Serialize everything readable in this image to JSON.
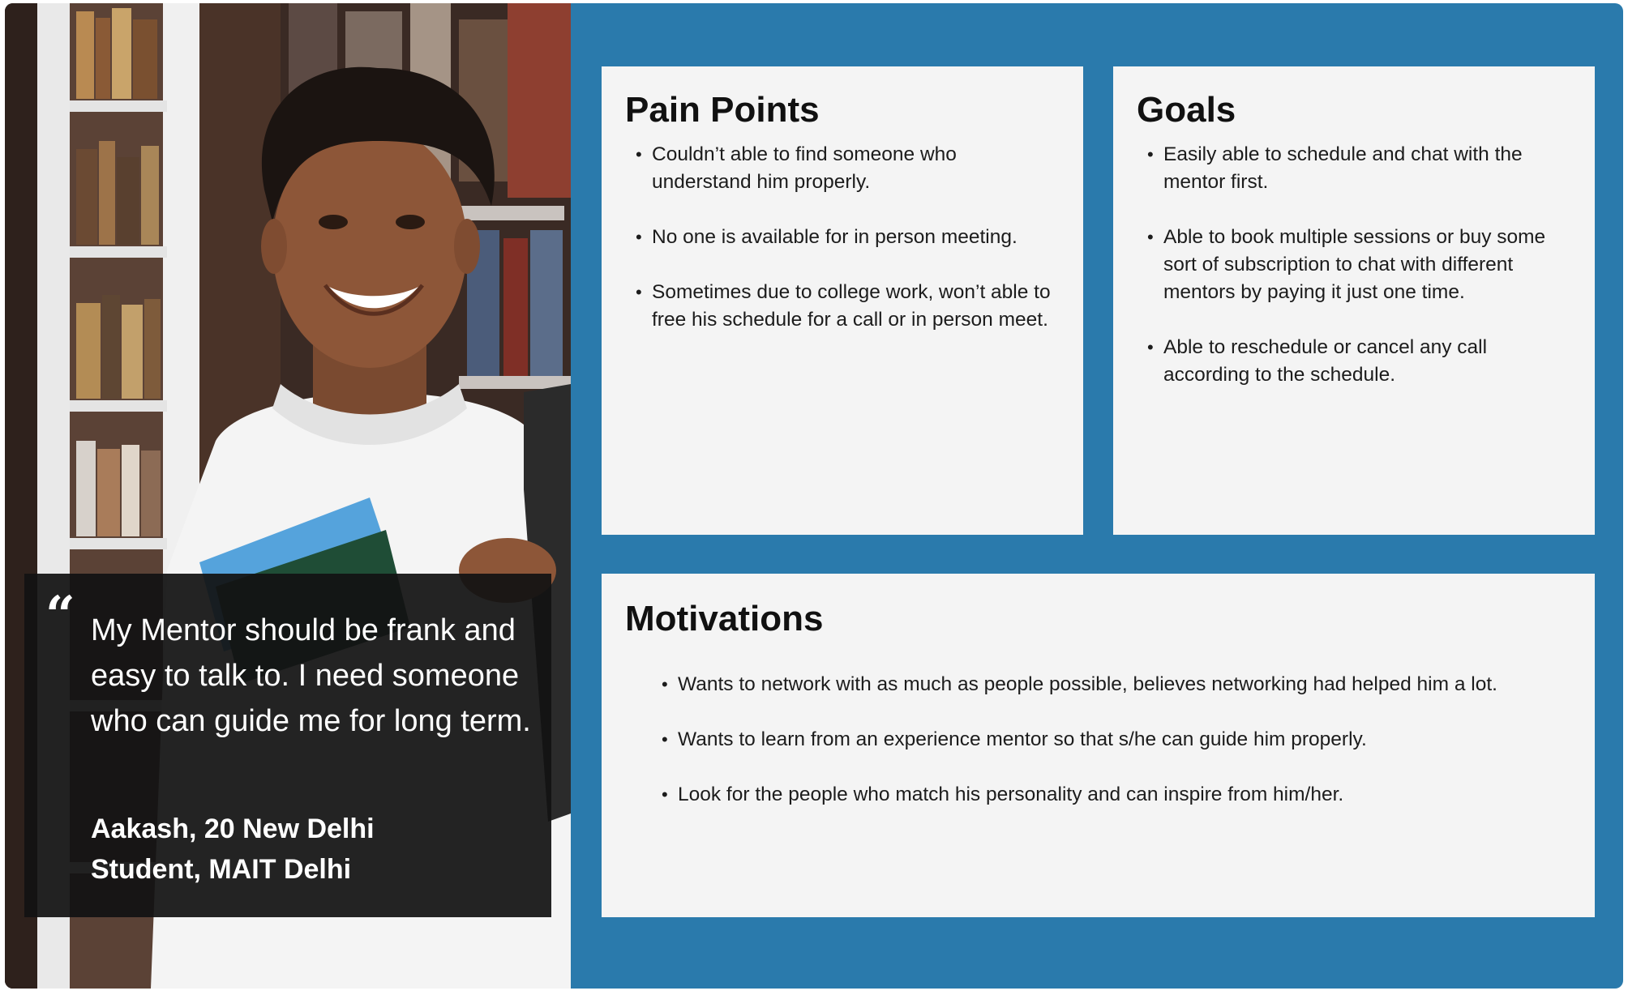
{
  "persona": {
    "quote": "My Mentor should be frank and easy to talk to. I need someone who can guide me for long term.",
    "quote_mark": "“",
    "name": "Aakash, 20 New Delhi",
    "role": "Student, MAIT Delhi"
  },
  "pain_points": {
    "title": "Pain Points",
    "items": [
      "Couldn’t able to find someone who understand him properly.",
      "No one is available for in person meeting.",
      "Sometimes due to college work, won’t able to free his schedule for a call or in person meet."
    ]
  },
  "goals": {
    "title": "Goals",
    "items": [
      "Easily able to schedule and chat with the mentor first.",
      "Able to book multiple sessions or buy some sort of subscription to chat with different mentors by paying it just one time.",
      "Able to reschedule or cancel any call according to the schedule."
    ]
  },
  "motivations": {
    "title": "Motivations",
    "items": [
      "Wants to network with as much as people possible, believes networking had helped him a lot.",
      "Wants to learn from an experience mentor so that s/he can guide him properly.",
      "Look for the people who match his personality and can inspire from him/her."
    ]
  },
  "colors": {
    "background": "#2a7aac",
    "card": "#f4f4f4",
    "quote_box": "#121212"
  }
}
